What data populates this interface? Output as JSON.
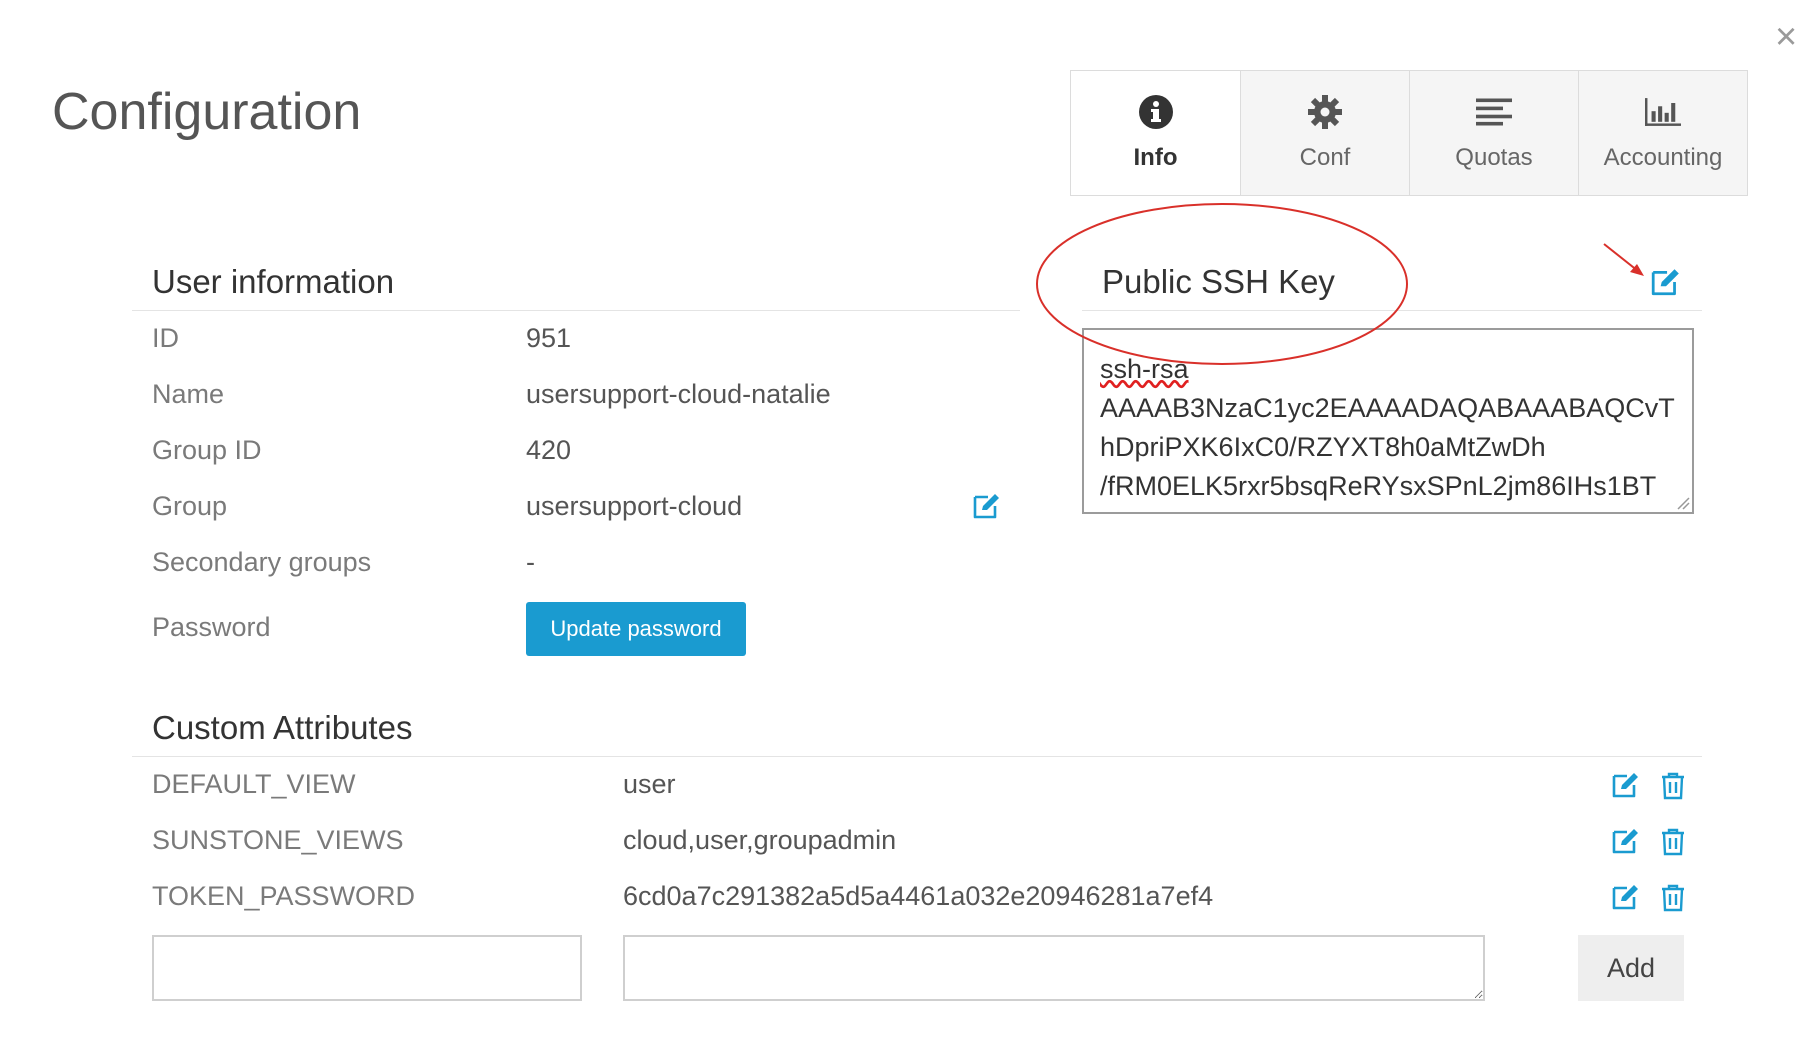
{
  "page": {
    "title": "Configuration",
    "close_glyph": "×"
  },
  "tabs": [
    {
      "label": "Info",
      "icon": "info-icon",
      "active": true
    },
    {
      "label": "Conf",
      "icon": "gear-icon",
      "active": false
    },
    {
      "label": "Quotas",
      "icon": "align-left-icon",
      "active": false
    },
    {
      "label": "Accounting",
      "icon": "bar-chart-icon",
      "active": false
    }
  ],
  "user_info": {
    "title": "User information",
    "rows": [
      {
        "label": "ID",
        "value": "951"
      },
      {
        "label": "Name",
        "value": "usersupport-cloud-natalie"
      },
      {
        "label": "Group ID",
        "value": "420"
      },
      {
        "label": "Group",
        "value": "usersupport-cloud"
      },
      {
        "label": "Secondary groups",
        "value": "-"
      },
      {
        "label": "Password",
        "value": ""
      }
    ],
    "update_password_label": "Update password"
  },
  "ssh": {
    "title": "Public SSH Key",
    "lines": [
      "ssh-rsa",
      "AAAAB3NzaC1yc2EAAAADAQABAAABAQCvT",
      "hDpriPXK6IxC0/RZYXT8h0aMtZwDh",
      "/fRM0ELK5rxr5bsqReRYsxSPnL2jm86IHs1BT"
    ]
  },
  "custom_attributes": {
    "title": "Custom Attributes",
    "rows": [
      {
        "key": "DEFAULT_VIEW",
        "value": "user"
      },
      {
        "key": "SUNSTONE_VIEWS",
        "value": "cloud,user,groupadmin"
      },
      {
        "key": "TOKEN_PASSWORD",
        "value": "6cd0a7c291382a5d5a4461a032e20946281a7ef4"
      }
    ],
    "new_key_value": "",
    "new_value_value": "",
    "add_label": "Add"
  },
  "colors": {
    "accent": "#1a9bd0",
    "annotation": "#d9302a"
  }
}
